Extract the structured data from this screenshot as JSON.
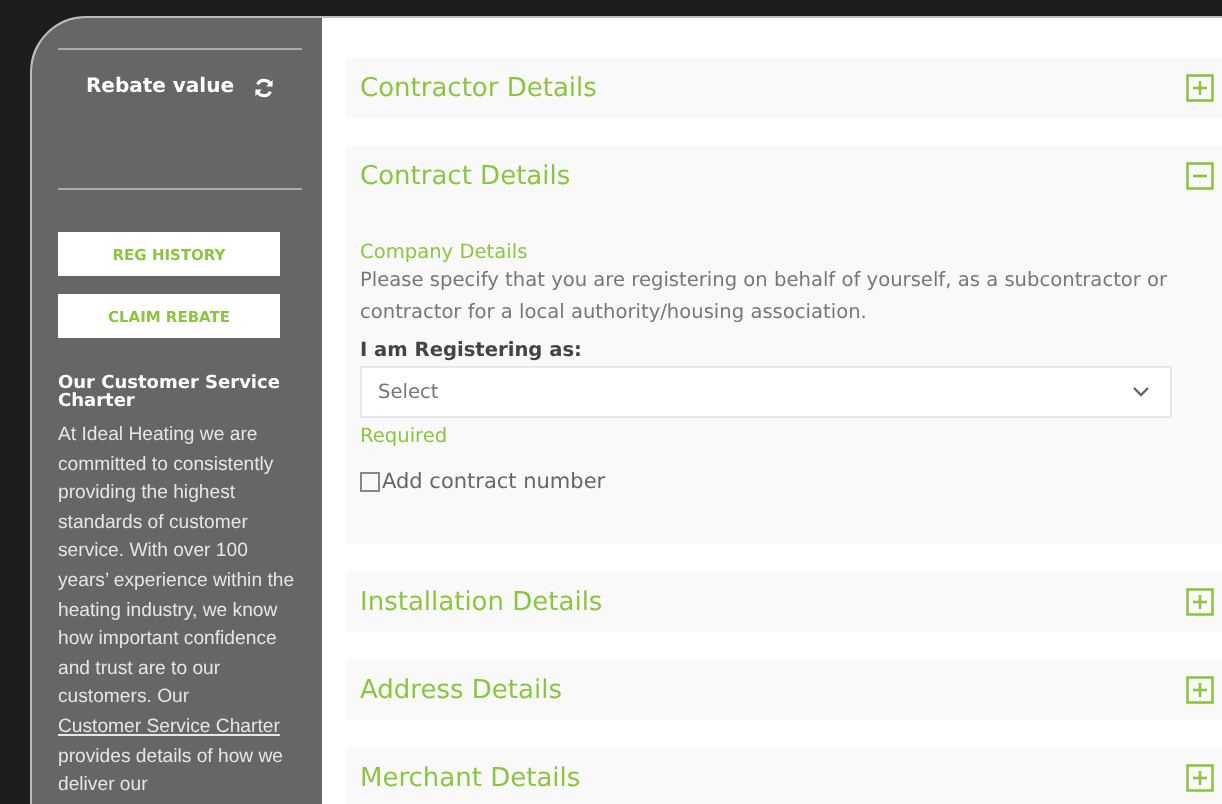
{
  "sidebar": {
    "rebate_label": "Rebate value",
    "buttons": [
      "REG HISTORY",
      "CLAIM REBATE"
    ],
    "charter": {
      "heading": "Our Customer Service Charter",
      "text_before": "At Ideal Heating we are committed to consistently providing the highest standards of customer service. With over 100 years’ experience within the heating industry, we know how important confidence and trust are to our customers. Our ",
      "link": "Customer Service Charter",
      "text_after": " provides details of how we deliver our"
    }
  },
  "sections": [
    {
      "title": "Contractor Details",
      "expanded": false
    },
    {
      "title": "Contract Details",
      "expanded": true,
      "body": {
        "subheading": "Company Details",
        "description": "Please specify that you are registering on behalf of yourself, as a subcontractor or contractor for a local authority/housing association.",
        "field_label": "I am Registering as:",
        "select": {
          "placeholder": "Select"
        },
        "validation": "Required",
        "checkbox": {
          "label": "Add contract number",
          "checked": false
        }
      }
    },
    {
      "title": "Installation Details",
      "expanded": false
    },
    {
      "title": "Address Details",
      "expanded": false
    },
    {
      "title": "Merchant Details",
      "expanded": false
    }
  ]
}
